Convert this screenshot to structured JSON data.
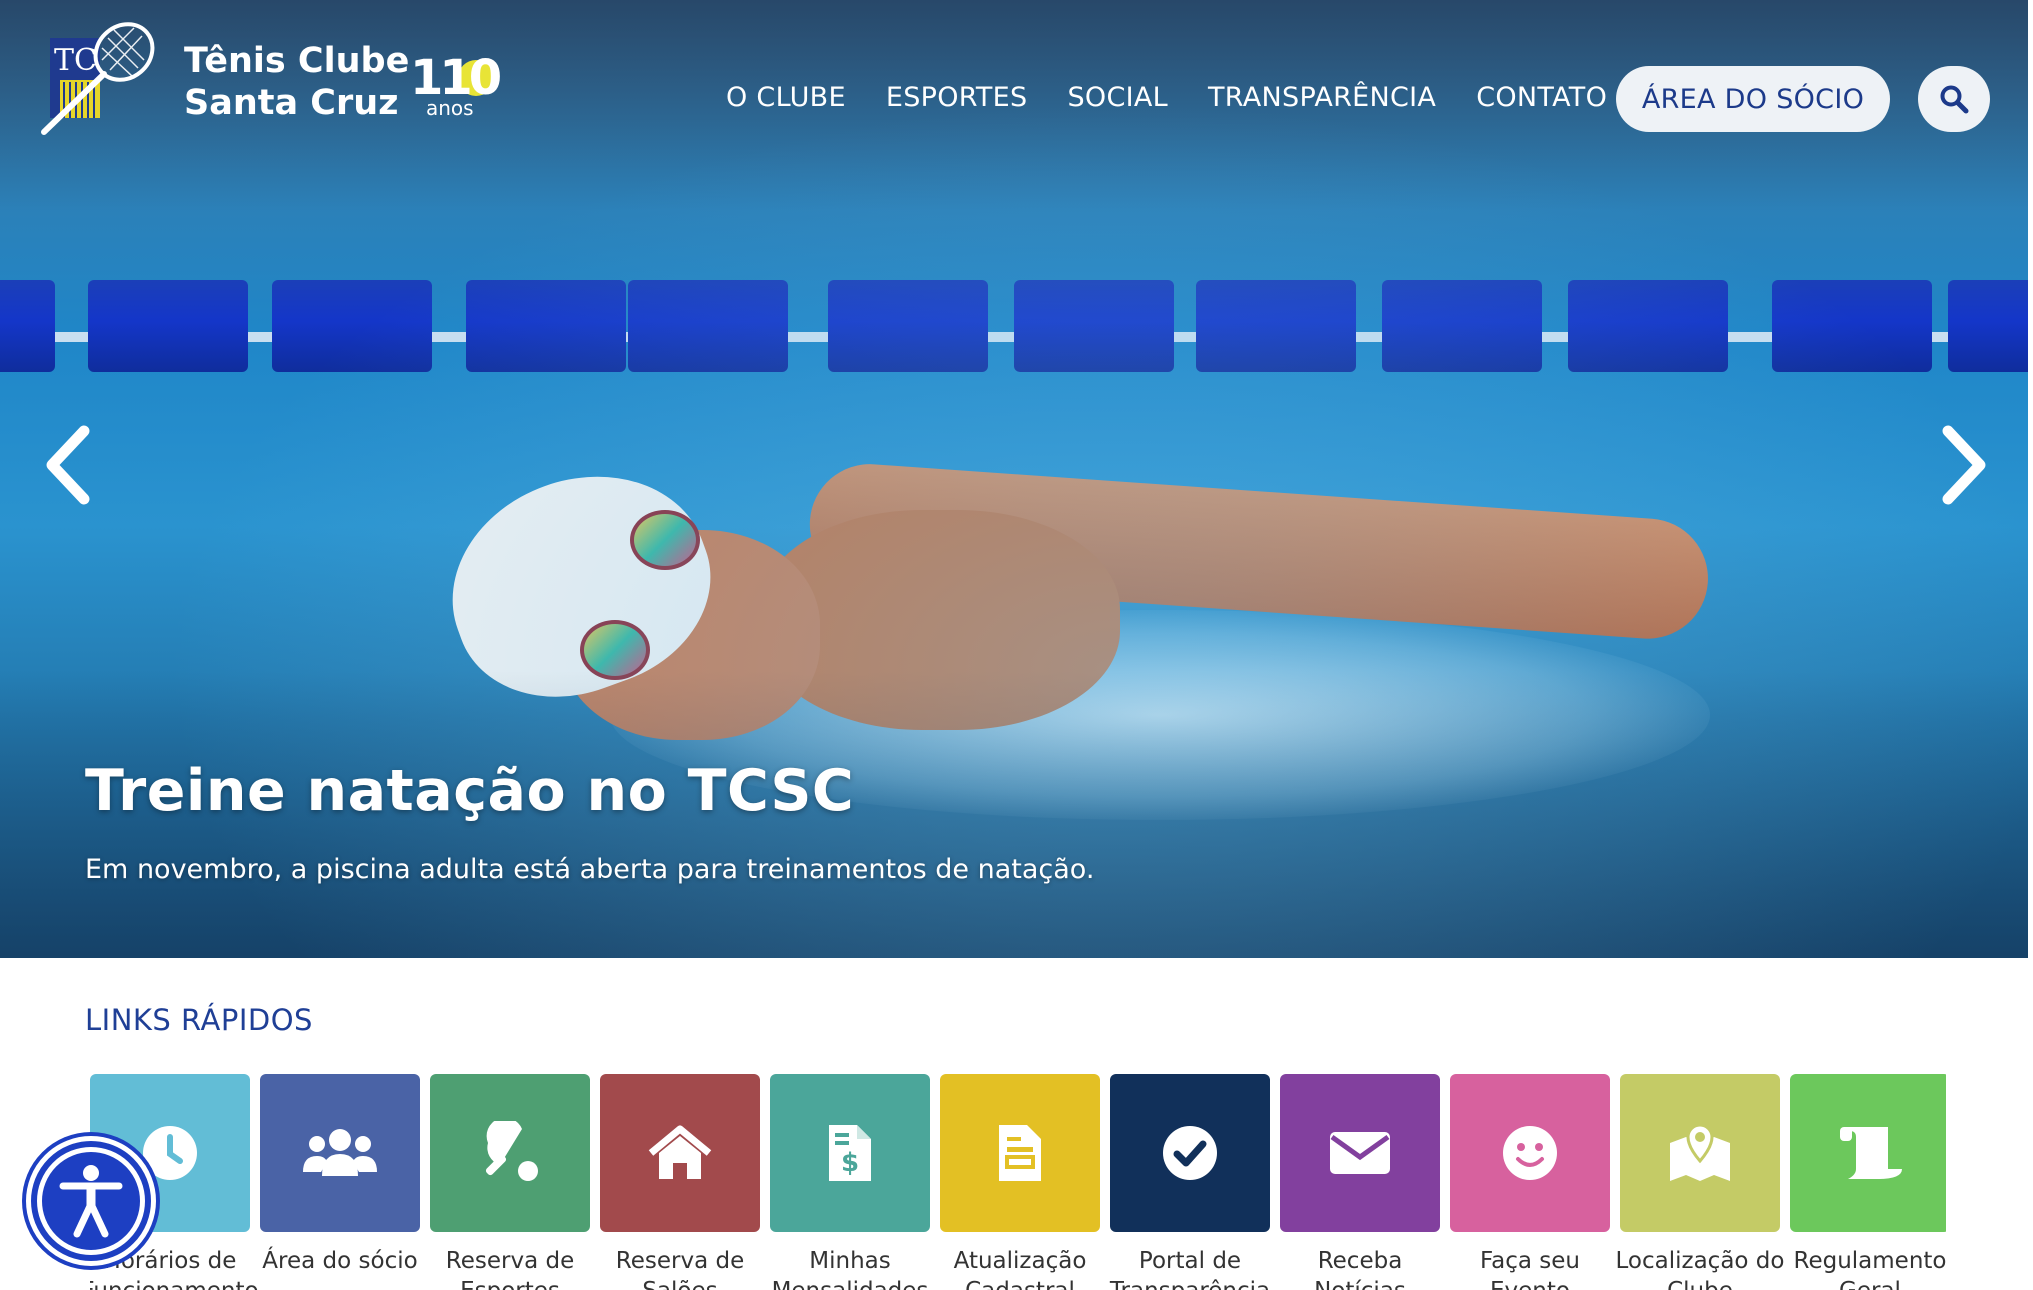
{
  "header": {
    "brand_line1": "Tênis Clube",
    "brand_line2": "Santa Cruz",
    "anniversary_number": "110",
    "anniversary_unit": "anos",
    "nav": [
      {
        "label": "O CLUBE"
      },
      {
        "label": "ESPORTES"
      },
      {
        "label": "SOCIAL"
      },
      {
        "label": "TRANSPARÊNCIA"
      },
      {
        "label": "CONTATO"
      }
    ],
    "member_area_label": "ÁREA DO SÓCIO",
    "search_icon": "search-icon"
  },
  "hero": {
    "title": "Treine natação no TCSC",
    "subtitle": "Em novembro, a piscina adulta está aberta para treinamentos de natação.",
    "prev_icon": "chevron-left-icon",
    "next_icon": "chevron-right-icon"
  },
  "quick_links": {
    "title": "LINKS RÁPIDOS",
    "items": [
      {
        "label": "Horários de Funcionamento",
        "icon": "clock-icon",
        "color": "#62bdd6"
      },
      {
        "label": "Área do sócio",
        "icon": "users-icon",
        "color": "#4a63a6"
      },
      {
        "label": "Reserva de Esportes",
        "icon": "table-tennis-icon",
        "color": "#4e9f72"
      },
      {
        "label": "Reserva de Salões",
        "icon": "home-icon",
        "color": "#a24a4c"
      },
      {
        "label": "Minhas Mensalidades",
        "icon": "invoice-icon",
        "color": "#4ba69a"
      },
      {
        "label": "Atualização Cadastral",
        "icon": "document-icon",
        "color": "#e3c024"
      },
      {
        "label": "Portal de Transparência",
        "icon": "check-circle-icon",
        "color": "#11305a"
      },
      {
        "label": "Receba Notícias",
        "icon": "envelope-icon",
        "color": "#82409e"
      },
      {
        "label": "Faça seu Evento",
        "icon": "smile-icon",
        "color": "#d7619e"
      },
      {
        "label": "Localização do Clube",
        "icon": "map-icon",
        "color": "#c4cb66"
      },
      {
        "label": "Regulamento Geral",
        "icon": "scroll-icon",
        "color": "#6cc85c"
      }
    ]
  },
  "accessibility": {
    "icon": "accessibility-icon"
  }
}
